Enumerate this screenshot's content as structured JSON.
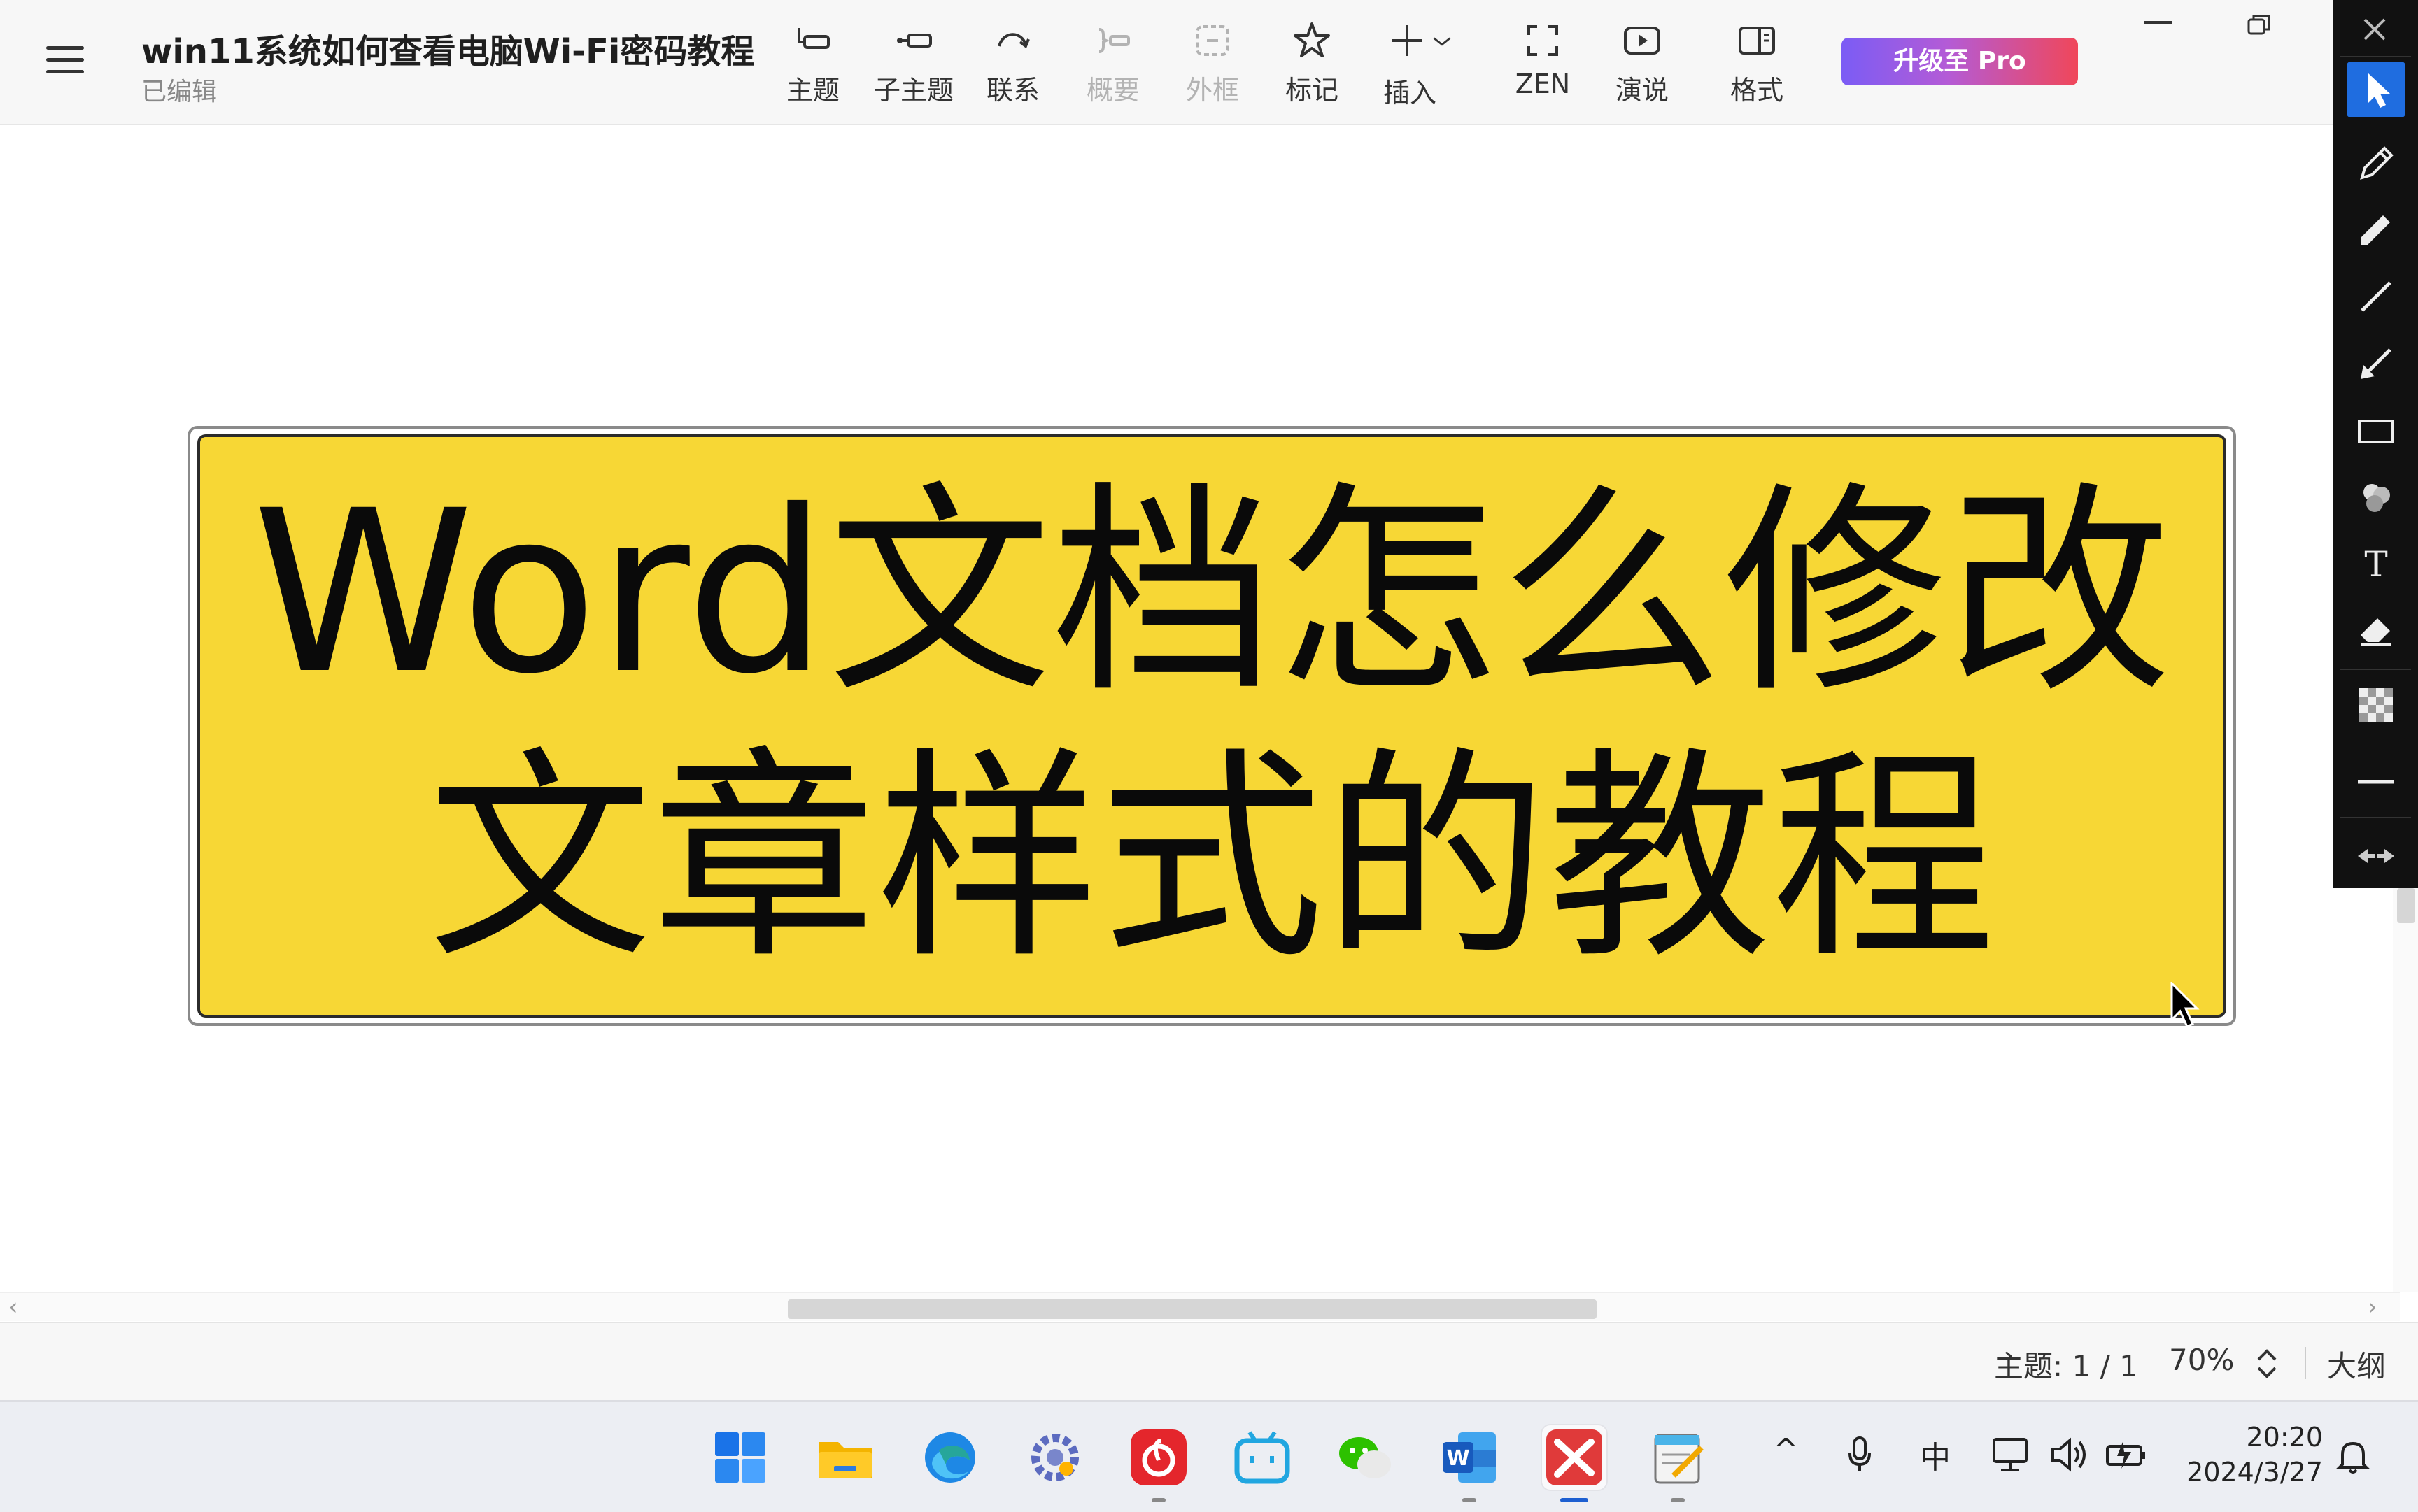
{
  "app": {
    "document_title": "win11系统如何查看电脑Wi-Fi密码教程",
    "document_status": "已编辑",
    "upgrade_button": "升级至 Pro"
  },
  "toolbar": {
    "tools": [
      {
        "label": "主题",
        "icon": "topic-icon",
        "enabled": true
      },
      {
        "label": "子主题",
        "icon": "subtopic-icon",
        "enabled": true
      },
      {
        "label": "联系",
        "icon": "relationship-icon",
        "enabled": true
      },
      {
        "label": "概要",
        "icon": "summary-icon",
        "enabled": false
      },
      {
        "label": "外框",
        "icon": "boundary-icon",
        "enabled": false
      },
      {
        "label": "标记",
        "icon": "star-icon",
        "enabled": true
      },
      {
        "label": "插入",
        "icon": "plus-icon",
        "enabled": true
      },
      {
        "label": "ZEN",
        "icon": "zen-icon",
        "enabled": true
      },
      {
        "label": "演说",
        "icon": "play-icon",
        "enabled": true
      },
      {
        "label": "格式",
        "icon": "format-panel-icon",
        "enabled": true
      }
    ]
  },
  "canvas": {
    "topic_text": "Word文档怎么修改文章样式的教程",
    "topic_fill": "#f7d735",
    "topic_border": "#2b2b2b"
  },
  "statusbar": {
    "topic_count": "主题: 1 / 1",
    "zoom": "70%",
    "outline_label": "大纲"
  },
  "taskbar": {
    "apps": [
      "windows-start-icon",
      "file-explorer-icon",
      "edge-icon",
      "settings-app-icon",
      "netease-music-icon",
      "bilibili-icon",
      "wechat-icon",
      "word-icon",
      "xmind-icon",
      "notepad-icon"
    ],
    "active_app": "xmind-icon",
    "tray": {
      "chevron": "^",
      "ime": "中"
    },
    "clock": {
      "time": "20:20",
      "date": "2024/3/27"
    }
  },
  "palette": {
    "tools": [
      "select-arrow-icon",
      "pencil-icon",
      "marker-icon",
      "line-icon",
      "arrow-icon",
      "rectangle-icon",
      "color-blob-icon",
      "text-tool-icon",
      "eraser-icon",
      "transparency-icon",
      "stroke-width-icon",
      "swap-side-icon"
    ],
    "active_tool": "select-arrow-icon",
    "text_tool_glyph": "T"
  }
}
